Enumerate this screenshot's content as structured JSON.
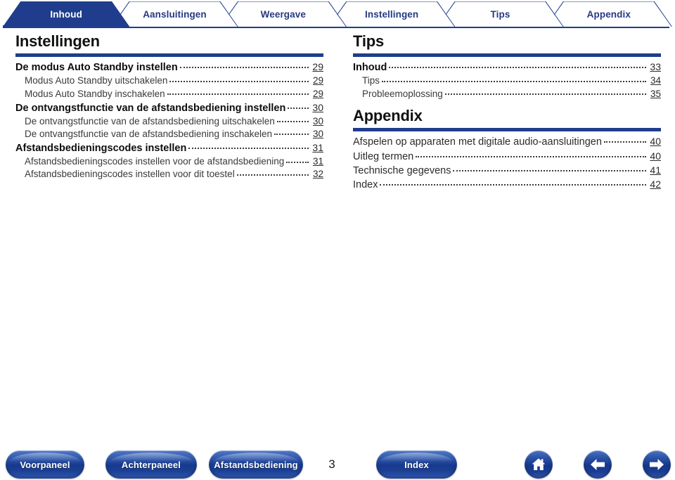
{
  "tabs": [
    {
      "label": "Inhoud",
      "active": true
    },
    {
      "label": "Aansluitingen",
      "active": false
    },
    {
      "label": "Weergave",
      "active": false
    },
    {
      "label": "Instellingen",
      "active": false
    },
    {
      "label": "Tips",
      "active": false
    },
    {
      "label": "Appendix",
      "active": false
    }
  ],
  "colors": {
    "brand_blue": "#1f3d8c",
    "tab_text": "#243a82",
    "rule": "#1f3d8c",
    "heading": "#111111"
  },
  "left_column": {
    "sections": [
      {
        "title": "Instellingen",
        "entries": [
          {
            "level": 1,
            "label": "De modus Auto Standby instellen",
            "page": "29"
          },
          {
            "level": 2,
            "label": "Modus Auto Standby uitschakelen",
            "page": "29"
          },
          {
            "level": 2,
            "label": "Modus Auto Standby inschakelen",
            "page": "29"
          },
          {
            "level": 1,
            "label": "De ontvangstfunctie van de afstandsbediening instellen",
            "page": "30"
          },
          {
            "level": 2,
            "label": "De ontvangstfunctie van de afstandsbediening uitschakelen",
            "page": "30"
          },
          {
            "level": 2,
            "label": "De ontvangstfunctie van de afstandsbediening inschakelen",
            "page": "30"
          },
          {
            "level": 1,
            "label": "Afstandsbedieningscodes instellen",
            "page": "31"
          },
          {
            "level": 2,
            "label": "Afstandsbedieningscodes instellen voor de afstandsbediening",
            "page": "31"
          },
          {
            "level": 2,
            "label": "Afstandsbedieningscodes instellen voor dit toestel",
            "page": "32"
          }
        ]
      }
    ]
  },
  "right_column": {
    "sections": [
      {
        "title": "Tips",
        "entries": [
          {
            "level": 1,
            "label": "Inhoud",
            "page": "33"
          },
          {
            "level": 2,
            "label": "Tips",
            "page": "34"
          },
          {
            "level": 2,
            "label": "Probleemoplossing",
            "page": "35"
          }
        ]
      },
      {
        "title": "Appendix",
        "entries": [
          {
            "level": 0,
            "label": "Afspelen op apparaten met digitale audio-aansluitingen",
            "page": "40"
          },
          {
            "level": 0,
            "label": "Uitleg termen",
            "page": "40"
          },
          {
            "level": 0,
            "label": "Technische gegevens",
            "page": "41"
          },
          {
            "level": 0,
            "label": "Index",
            "page": "42"
          }
        ]
      }
    ]
  },
  "footer": {
    "buttons": [
      {
        "id": "btn-voorpaneel",
        "label": "Voorpaneel"
      },
      {
        "id": "btn-achterpaneel",
        "label": "Achterpaneel"
      },
      {
        "id": "btn-afstandsbediening",
        "label": "Afstandsbediening"
      },
      {
        "id": "btn-index",
        "label": "Index"
      }
    ],
    "page_number": "3",
    "icon_buttons": [
      {
        "id": "btn-home",
        "icon": "home-icon"
      },
      {
        "id": "btn-prev",
        "icon": "arrow-left-icon"
      },
      {
        "id": "btn-next",
        "icon": "arrow-right-icon"
      }
    ]
  }
}
